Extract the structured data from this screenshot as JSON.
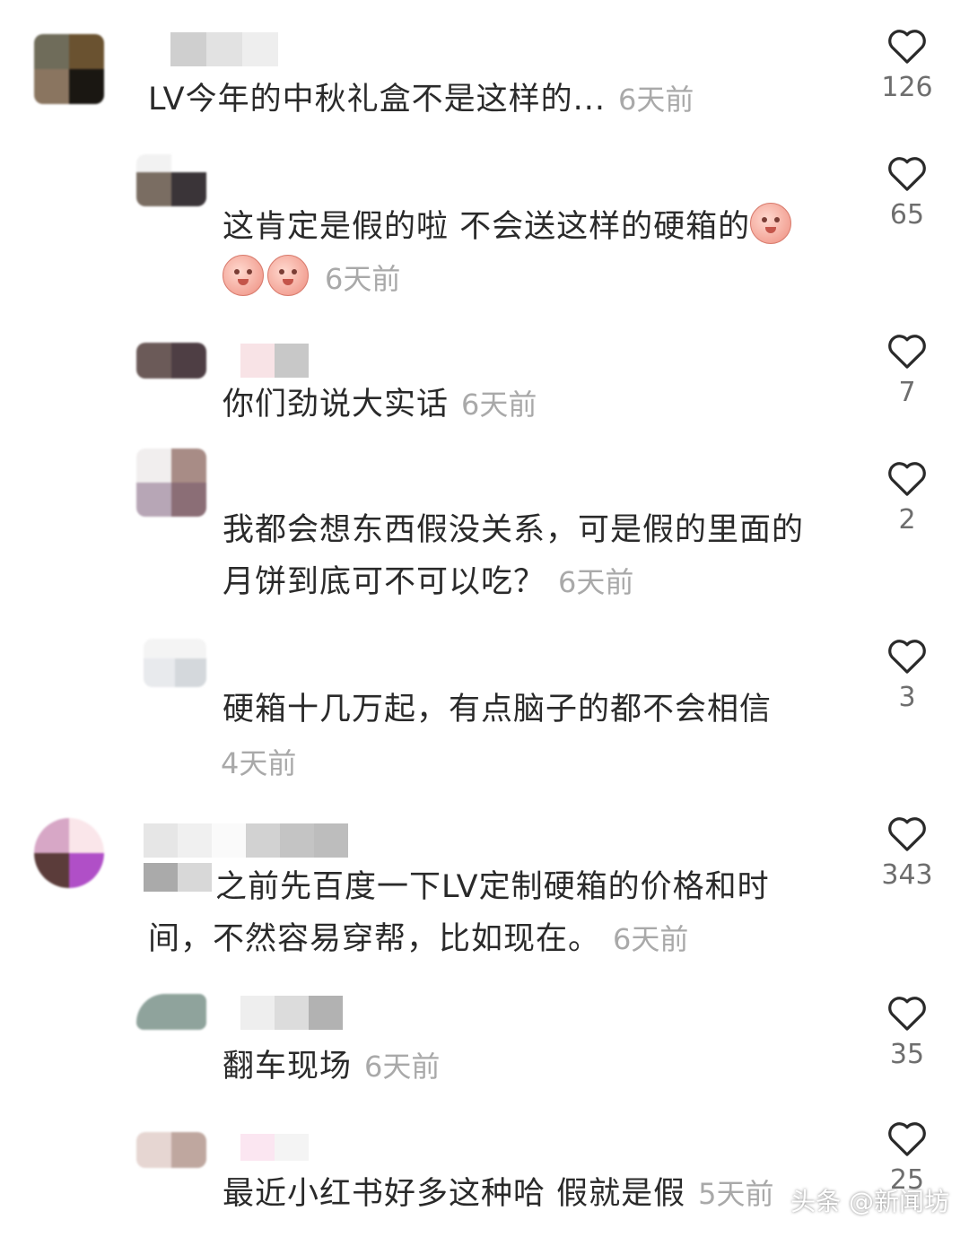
{
  "comments": [
    {
      "text": "LV今年的中秋礼盒不是这样的...",
      "time": "6天前",
      "likes": "126"
    },
    {
      "text_line1": "这肯定是假的啦 不会送这样的硬箱的",
      "time": "6天前",
      "likes": "65"
    },
    {
      "text": "你们劲说大实话",
      "time": "6天前",
      "likes": "7"
    },
    {
      "text_line1": "我都会想东西假没关系，可是假的里面的",
      "text_line2": "月饼到底可不可以吃？",
      "time": "6天前",
      "likes": "2"
    },
    {
      "text_line1": "硬箱十几万起，有点脑子的都不会相信",
      "time": "4天前",
      "likes": "3"
    },
    {
      "text_line1": "之前先百度一下LV定制硬箱的价格和时",
      "text_line2": "间，不然容易穿帮，比如现在。",
      "time": "6天前",
      "likes": "343"
    },
    {
      "text": "翻车现场",
      "time": "6天前",
      "likes": "35"
    },
    {
      "text": "最近小红书好多这种哈 假就是假",
      "time": "5天前",
      "likes": "25"
    }
  ],
  "watermark": "头条 @新闻坊",
  "colors": {
    "text": "#2a2a2a",
    "time": "#a9a9a9",
    "count": "#6e6e6e"
  },
  "icons": {
    "like": "heart-outline-icon",
    "emoji": "peach-emoji-icon"
  }
}
